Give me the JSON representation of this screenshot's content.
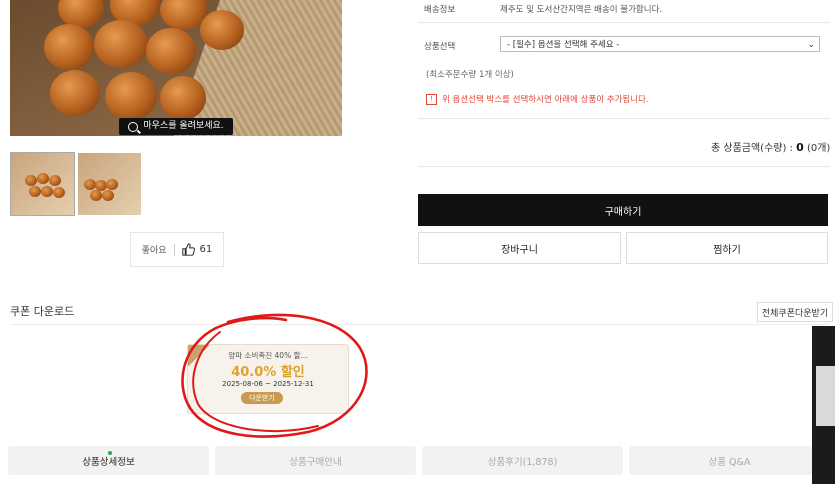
{
  "product": {
    "zoom_hint": "마우스를 올려보세요.",
    "like_label": "좋아요",
    "like_count": "61"
  },
  "info": {
    "shipping_label": "배송정보",
    "shipping_text": "제주도 및 도서산간지역은 배송이 불가합니다.",
    "option_label": "상품선택",
    "option_placeholder": "- [필수] 옵션을 선택해 주세요 -",
    "min_order": "(최소주문수량 1개 이상)",
    "warning": "위 옵션선택 박스를 선택하시면 아래에 상품이 추가됩니다.",
    "total_label": "총 상품금액(수량) :",
    "total_value": "0",
    "total_qty": "(0개)"
  },
  "actions": {
    "buy": "구매하기",
    "cart": "장바구니",
    "wish": "찜하기"
  },
  "coupons": {
    "section_title": "쿠폰 다운로드",
    "all_download": "전체쿠폰다운받기",
    "items": [
      {
        "name": "양파 소비촉진 40% 할...",
        "discount": "40.0% 할인",
        "period": "2025-08-06 ~ 2025-12-31",
        "button": "다운받기"
      }
    ]
  },
  "tabs": [
    {
      "label": "상품상세정보",
      "active": true
    },
    {
      "label": "상품구매안내",
      "active": false
    },
    {
      "label": "상품후기(1,878)",
      "active": false
    },
    {
      "label": "상품 Q&A",
      "active": false
    }
  ],
  "colors": {
    "accent_annotation": "#e01818",
    "coupon_discount": "#e0a12a",
    "buy_button": "#111111",
    "warning": "#e04a3a"
  }
}
